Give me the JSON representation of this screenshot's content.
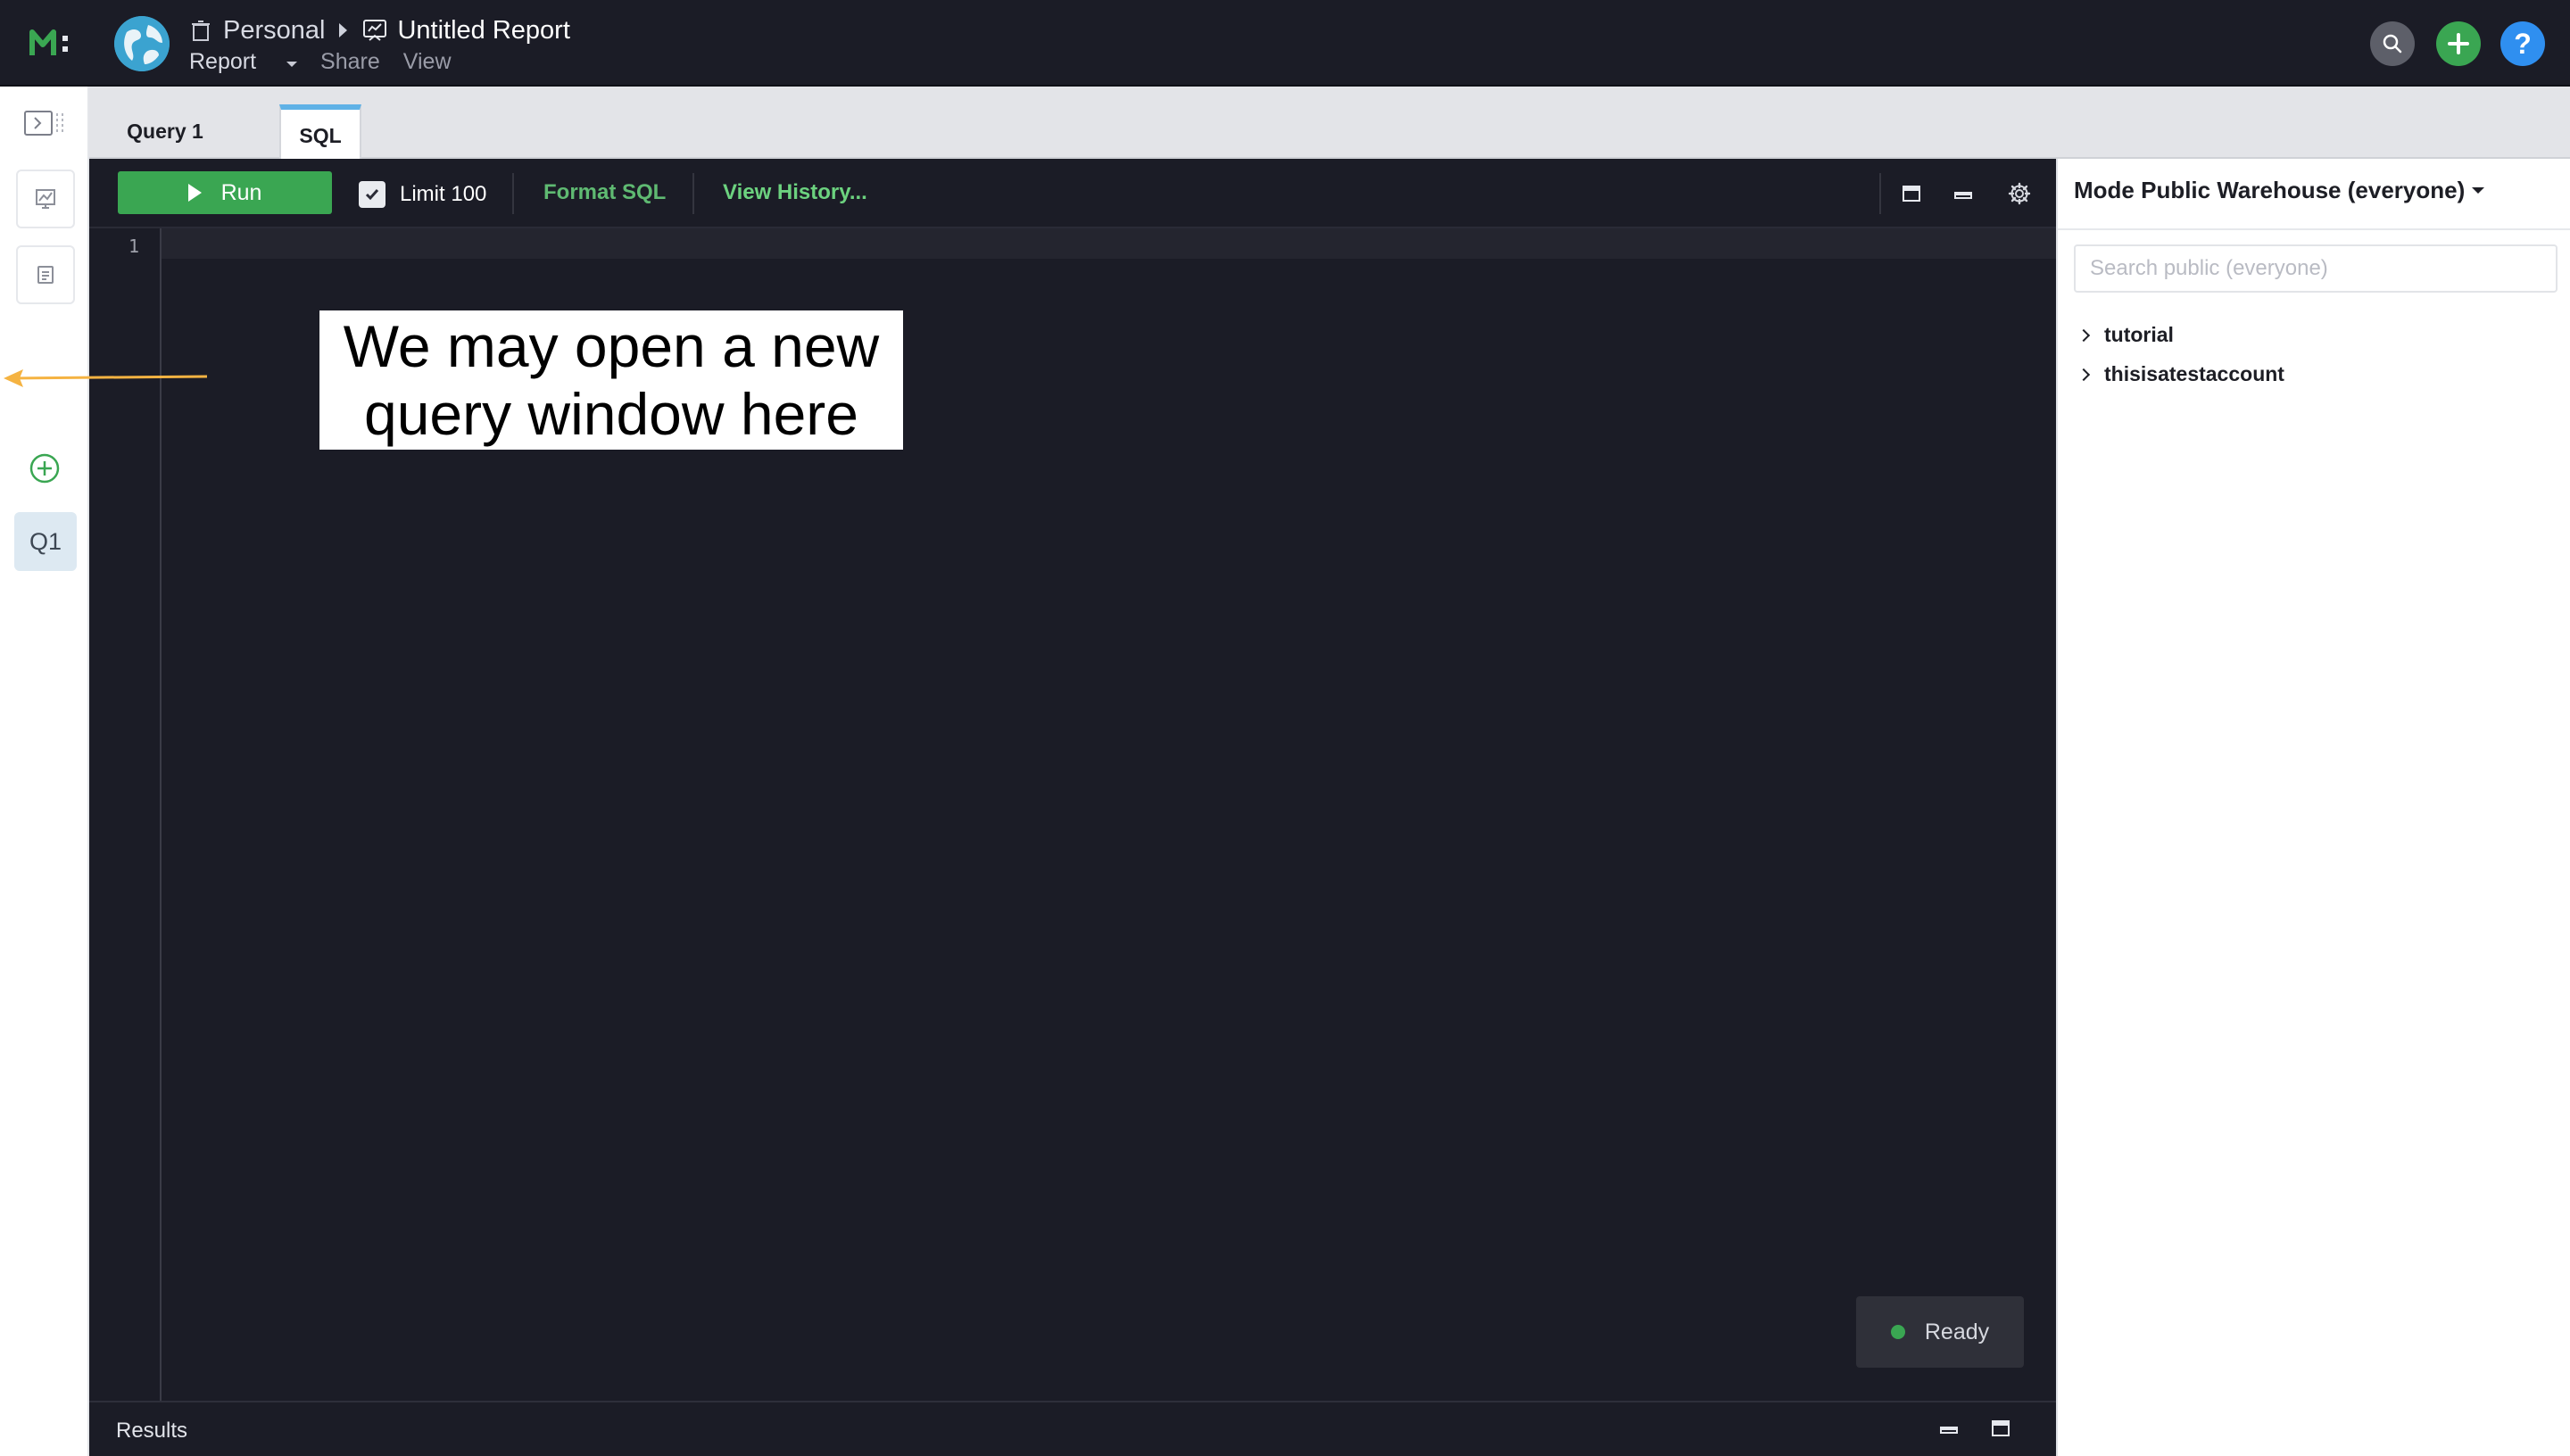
{
  "header": {
    "breadcrumb_space": "Personal",
    "report_title": "Untitled Report",
    "menu_report": "Report",
    "menu_share": "Share",
    "menu_view": "View",
    "help_label": "?"
  },
  "rail": {
    "query_badge": "Q1"
  },
  "tabs": {
    "query_tab": "Query 1",
    "sql_tab": "SQL"
  },
  "toolbar": {
    "run_label": "Run",
    "limit_label": "Limit 100",
    "limit_checked": true,
    "format_label": "Format SQL",
    "history_label": "View History..."
  },
  "editor": {
    "line_number": "1",
    "annotation_line1": "We may open a new",
    "annotation_line2": "query window here",
    "status": "Ready"
  },
  "results": {
    "label": "Results"
  },
  "right_panel": {
    "warehouse": "Mode Public Warehouse (everyone)",
    "search_placeholder": "Search public (everyone)",
    "schemas": [
      "tutorial",
      "thisisatestaccount"
    ]
  },
  "colors": {
    "accent_green": "#3aa652",
    "link_green": "#6cd27f",
    "help_blue": "#2f8ff0",
    "annotation_arrow": "#f5b342",
    "editor_bg": "#1b1c26"
  }
}
